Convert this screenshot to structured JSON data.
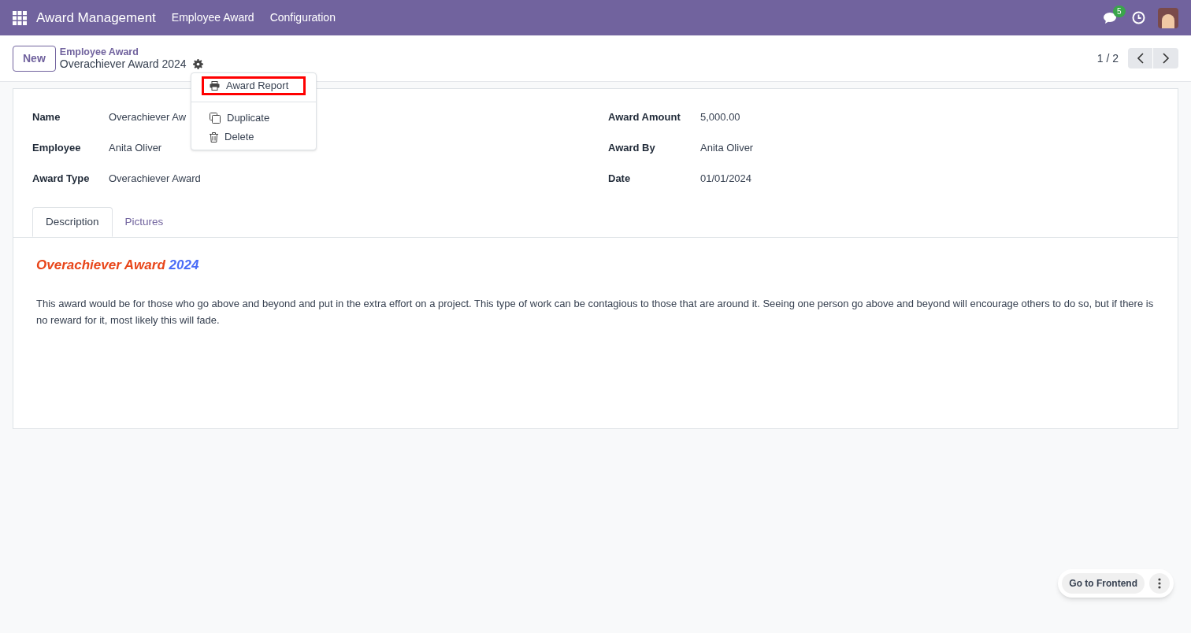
{
  "navbar": {
    "app_name": "Award Management",
    "menu": [
      {
        "label": "Employee Award"
      },
      {
        "label": "Configuration"
      }
    ],
    "message_count": "5"
  },
  "control_panel": {
    "new_button": "New",
    "breadcrumb": "Employee Award",
    "record_title": "Overachiever Award 2024",
    "pager": "1 / 2"
  },
  "action_menu": [
    {
      "kind": "print",
      "label": "Award Report",
      "highlighted": true
    },
    {
      "kind": "divider"
    },
    {
      "kind": "duplicate",
      "label": "Duplicate",
      "highlighted": false
    },
    {
      "kind": "delete",
      "label": "Delete",
      "highlighted": false
    }
  ],
  "fields_left": [
    {
      "label": "Name",
      "value": "Overachiever Aw"
    },
    {
      "label": "Employee",
      "value": "Anita Oliver"
    },
    {
      "label": "Award Type",
      "value": "Overachiever Award"
    }
  ],
  "fields_right": [
    {
      "label": "Award Amount",
      "value": "5,000.00"
    },
    {
      "label": "Award By",
      "value": "Anita Oliver"
    },
    {
      "label": "Date",
      "value": "01/01/2024"
    }
  ],
  "tabs": [
    {
      "label": "Description",
      "selected": true
    },
    {
      "label": "Pictures",
      "selected": false
    }
  ],
  "description": {
    "heading": [
      {
        "text": "Overachiever Award",
        "color": "#e8461a"
      },
      {
        "text": "2024",
        "color": "#4a6cf7"
      }
    ],
    "body": "This award would be for those who go above and beyond and put in the extra effort on a project. This type of work can be contagious to those that are around it. Seeing one person go above and beyond will encourage others to do so, but if there is no reward for it, most likely this will fade."
  },
  "floating": {
    "button": "Go to Frontend"
  }
}
